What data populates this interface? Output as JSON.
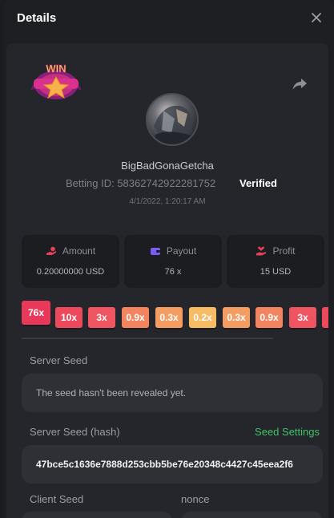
{
  "header": {
    "title": "Details"
  },
  "badge": {
    "text": "WIN"
  },
  "user": {
    "username": "BigBadGonaGetcha",
    "betting_id_label": "Betting ID:",
    "betting_id": "58362742922281752",
    "verified_label": "Verified",
    "datetime": "4/1/2022, 1:20:17 AM"
  },
  "stats": {
    "amount": {
      "label": "Amount",
      "value": "0.20000000 USD",
      "icon": "hand-coin-icon",
      "color": "#e8415a"
    },
    "payout": {
      "label": "Payout",
      "value": "76 x",
      "icon": "wallet-icon",
      "color": "#7a5cf0"
    },
    "profit": {
      "label": "Profit",
      "value": "15 USD",
      "icon": "hand-heart-icon",
      "color": "#e8415a"
    }
  },
  "multipliers": [
    {
      "label": "76x",
      "color": "#e8395a"
    },
    {
      "label": "10x",
      "color": "#ec4a5c"
    },
    {
      "label": "3x",
      "color": "#ee5560"
    },
    {
      "label": "0.9x",
      "color": "#f2845f"
    },
    {
      "label": "0.3x",
      "color": "#f39d63"
    },
    {
      "label": "0.2x",
      "color": "#f6bb63"
    },
    {
      "label": "0.3x",
      "color": "#f39d63"
    },
    {
      "label": "0.9x",
      "color": "#f2845f"
    },
    {
      "label": "3x",
      "color": "#ee5560"
    },
    {
      "label": "",
      "color": "#ec4a5c"
    }
  ],
  "server_seed": {
    "label": "Server Seed",
    "value": "The seed hasn't been revealed yet."
  },
  "server_seed_hash": {
    "label": "Server Seed (hash)",
    "value": "47bce5c1636e7888d253cbb5be76e20348c4427c45eea2f6",
    "settings_link": "Seed Settings"
  },
  "client_seed": {
    "label": "Client Seed"
  },
  "nonce": {
    "label": "nonce"
  }
}
